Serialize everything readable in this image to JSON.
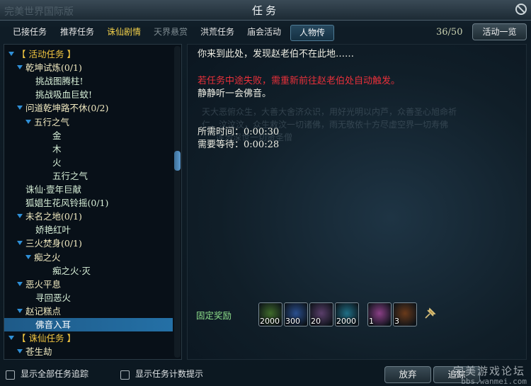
{
  "window": {
    "title": "任务",
    "watermark": "完美世界国际版"
  },
  "tabs": [
    {
      "label": "已接任务",
      "state": "normal"
    },
    {
      "label": "推荐任务",
      "state": "normal"
    },
    {
      "label": "诛仙剧情",
      "state": "story"
    },
    {
      "label": "天界悬赏",
      "state": "disabled"
    },
    {
      "label": "洪荒任务",
      "state": "normal"
    },
    {
      "label": "庙会活动",
      "state": "normal"
    },
    {
      "label": "人物传",
      "state": "active"
    }
  ],
  "pager": "36/50",
  "activity_list_button": "活动一览",
  "tree": [
    {
      "level": 0,
      "type": "cat",
      "label": "【 活动任务 】",
      "expanded": true
    },
    {
      "level": 1,
      "type": "grp",
      "label": "乾坤试炼(0/1)",
      "expanded": true
    },
    {
      "level": 2,
      "type": "quest",
      "label": "挑战图腾柱!"
    },
    {
      "level": 2,
      "type": "quest",
      "label": "挑战吸血巨蚊!"
    },
    {
      "level": 1,
      "type": "grp",
      "label": "问道乾坤路不休(0/2)",
      "expanded": true
    },
    {
      "level": 2,
      "type": "grp",
      "label": "五行之气",
      "expanded": true
    },
    {
      "level": 3,
      "type": "quest",
      "label": "金"
    },
    {
      "level": 3,
      "type": "quest",
      "label": "木"
    },
    {
      "level": 3,
      "type": "quest",
      "label": "火"
    },
    {
      "level": 3,
      "type": "quest",
      "label": "五行之气"
    },
    {
      "level": 1,
      "type": "quest",
      "label": "诛仙·壹年巨献"
    },
    {
      "level": 1,
      "type": "quest",
      "label": "狐娼生花风铃摇(0/1)"
    },
    {
      "level": 1,
      "type": "grp",
      "label": "未名之地(0/1)",
      "expanded": true
    },
    {
      "level": 2,
      "type": "quest",
      "label": "娇艳红叶"
    },
    {
      "level": 1,
      "type": "grp",
      "label": "三火焚身(0/1)",
      "expanded": true
    },
    {
      "level": 2,
      "type": "grp",
      "label": "痴之火",
      "expanded": true
    },
    {
      "level": 3,
      "type": "quest",
      "label": "痴之火·灭"
    },
    {
      "level": 1,
      "type": "grp",
      "label": "恶火平息",
      "expanded": true
    },
    {
      "level": 2,
      "type": "quest",
      "label": "寻回恶火"
    },
    {
      "level": 1,
      "type": "grp",
      "label": "赵记糕点",
      "expanded": true
    },
    {
      "level": 2,
      "type": "quest",
      "label": "佛音入耳",
      "selected": true
    },
    {
      "level": 0,
      "type": "cat",
      "label": "【 诛仙任务 】",
      "expanded": true
    },
    {
      "level": 1,
      "type": "grp",
      "label": "苍生劫",
      "expanded": true
    }
  ],
  "detail": {
    "intro": "你来到此处，发现赵老伯不在此地……",
    "warning": "若任务中途失败，需重新前往赵老伯处自动触发。",
    "objective": "静静听一会佛音。",
    "time_required": "所需时间：0:00:30",
    "wait_time": "需要等待：0:00:28",
    "background_text": [
      "天大恶俯众生，大善大舍济众识，用好光明以内芦，众善圣心旭命祈",
      "仁，汶汶汶，众生救汶一切诸佛，雨无敬依十方尽虚空界一切寿佛",
      "莲池深世一切贤圣僧"
    ]
  },
  "rewards": {
    "label": "固定奖励",
    "items": [
      {
        "icon": "green-flask-icon",
        "qty": "2000",
        "color": "#3f6a2a"
      },
      {
        "icon": "blue-feather-icon",
        "qty": "300",
        "color": "#2a4f8f"
      },
      {
        "icon": "spiral-orb-icon",
        "qty": "20",
        "color": "#5a3e6a"
      },
      {
        "icon": "cyan-orb-icon",
        "qty": "2000",
        "color": "#1f6f86"
      },
      {
        "icon": "pink-orb-icon",
        "qty": "1",
        "color": "#8a3f86"
      },
      {
        "icon": "fire-emblem-icon",
        "qty": "3",
        "color": "#6a3a1a"
      }
    ]
  },
  "footer": {
    "show_all_track": "显示全部任务追踪",
    "show_counter": "显示任务计数提示",
    "abandon": "放弃",
    "track": "追踪",
    "watermark": "完美游戏论坛",
    "watermark_url": "bbs.wanmei.com"
  }
}
